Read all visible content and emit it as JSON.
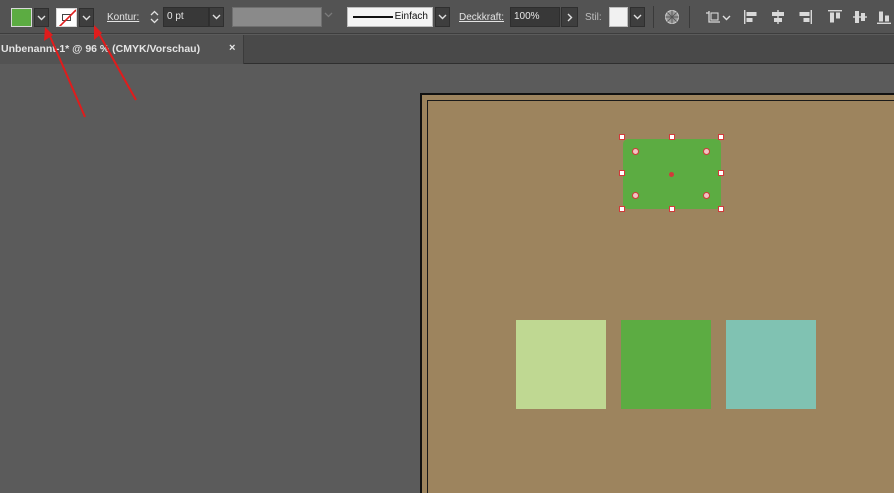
{
  "colors": {
    "fill": "#5cac42",
    "selected_rect": "#5cac42",
    "artboard": "#9d845e",
    "swatch_light_green": "#bfd892",
    "swatch_green": "#5cac42",
    "swatch_teal": "#80c2b2",
    "selection": "#d23a3a",
    "annotation_arrow": "#e01c1c"
  },
  "controlbar": {
    "fill_icon": "fill-swatch",
    "stroke_icon": "stroke-none-swatch",
    "stroke_label": "Kontur:",
    "stroke_weight": "0 pt",
    "stroke_style_label": "Einfach",
    "opacity_label": "Deckkraft:",
    "opacity_value": "100%",
    "style_label": "Stil:"
  },
  "tab": {
    "title": "Unbenannt-1* @ 96 % (CMYK/Vorschau)",
    "close": "×"
  }
}
